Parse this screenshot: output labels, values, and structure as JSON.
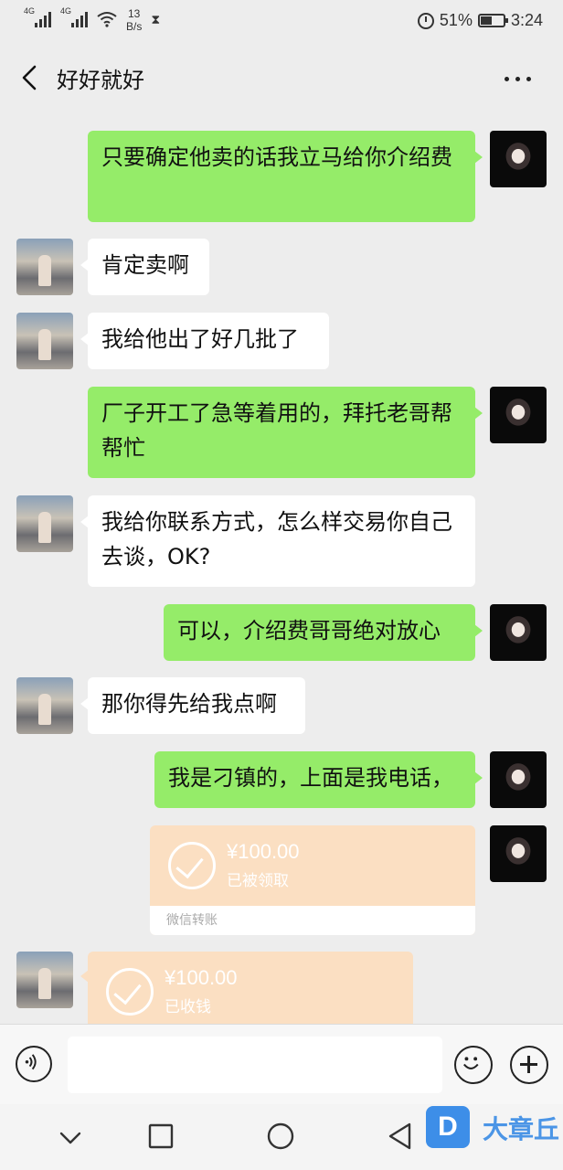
{
  "status_bar": {
    "signal1_label": "4G",
    "signal2_label": "4G",
    "net_speed_value": "13",
    "net_speed_unit": "B/s",
    "battery_percent": "51%",
    "battery_level": 0.51,
    "time": "3:24"
  },
  "header": {
    "title": "好好就好",
    "back_icon": "chevron-left-icon",
    "more_icon": "more-horizontal-icon"
  },
  "messages": [
    {
      "from": "me",
      "text": "只要确定他卖的话我立马给你介绍费"
    },
    {
      "from": "other",
      "text": "肯定卖啊"
    },
    {
      "from": "other",
      "text": "我给他出了好几批了"
    },
    {
      "from": "me",
      "text": "厂子开工了急等着用的，拜托老哥帮帮忙"
    },
    {
      "from": "other",
      "text": "我给你联系方式，怎么样交易你自己去谈，OK?"
    },
    {
      "from": "me",
      "text": "可以，介绍费哥哥绝对放心"
    },
    {
      "from": "other",
      "text": "那你得先给我点啊"
    },
    {
      "from": "me",
      "text": "我是刁镇的，上面是我电话，"
    },
    {
      "from": "me",
      "type": "transfer",
      "amount": "¥100.00",
      "status": "已被领取",
      "footer": "微信转账"
    },
    {
      "from": "other",
      "type": "transfer",
      "amount": "¥100.00",
      "status": "已收钱"
    }
  ],
  "input_bar": {
    "voice_icon": "voice-icon",
    "emoji_icon": "emoji-icon",
    "plus_icon": "plus-icon"
  },
  "system_nav": {
    "icons": [
      "chevron-down-icon",
      "square-icon",
      "circle-icon",
      "triangle-back-icon"
    ]
  },
  "watermark": {
    "logo_letter": "D",
    "text": "大章丘"
  },
  "colors": {
    "me_bubble": "#95ec69",
    "other_bubble": "#ffffff",
    "transfer_bg": "#fbdfc2",
    "background": "#ededed"
  }
}
